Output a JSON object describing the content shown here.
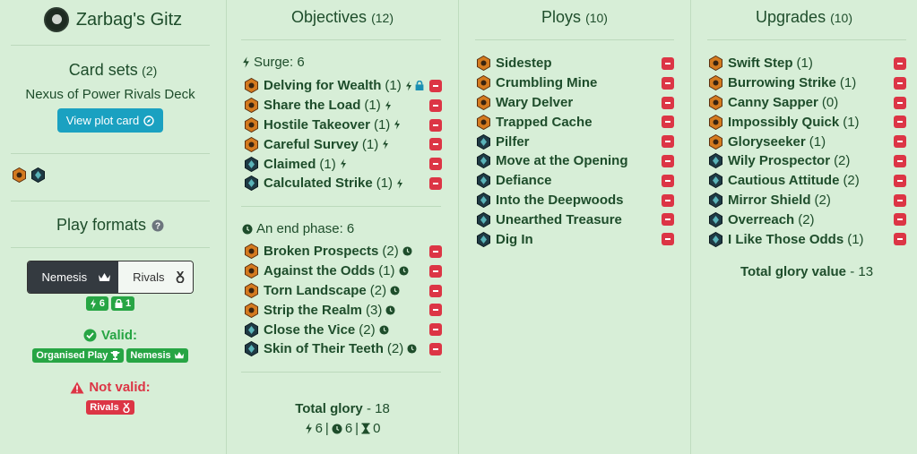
{
  "sidebar": {
    "warband_name": "Zarbag's Gitz",
    "card_sets": {
      "title": "Card sets",
      "count": "(2)",
      "deck_name": "Nexus of Power Rivals Deck",
      "plot_button": "View plot card"
    },
    "play_formats": {
      "title": "Play formats",
      "nemesis_label": "Nemesis",
      "rivals_label": "Rivals",
      "surge_count": "6",
      "lock_count": "1",
      "valid_label": "Valid:",
      "valid_badges": [
        "Organised Play",
        "Nemesis"
      ],
      "invalid_label": "Not valid:",
      "invalid_badges": [
        "Rivals"
      ]
    }
  },
  "objectives": {
    "title": "Objectives",
    "count": "(12)",
    "surge_group": {
      "label": "Surge: 6",
      "cards": [
        {
          "name": "Delving for Wealth",
          "glory": "(1)",
          "set": "orange",
          "lock": true
        },
        {
          "name": "Share the Load",
          "glory": "(1)",
          "set": "orange"
        },
        {
          "name": "Hostile Takeover",
          "glory": "(1)",
          "set": "orange"
        },
        {
          "name": "Careful Survey",
          "glory": "(1)",
          "set": "orange"
        },
        {
          "name": "Claimed",
          "glory": "(1)",
          "set": "dark"
        },
        {
          "name": "Calculated Strike",
          "glory": "(1)",
          "set": "dark"
        }
      ]
    },
    "end_group": {
      "label": "An end phase: 6",
      "cards": [
        {
          "name": "Broken Prospects",
          "glory": "(2)",
          "set": "orange"
        },
        {
          "name": "Against the Odds",
          "glory": "(1)",
          "set": "orange"
        },
        {
          "name": "Torn Landscape",
          "glory": "(2)",
          "set": "orange"
        },
        {
          "name": "Strip the Realm",
          "glory": "(3)",
          "set": "orange"
        },
        {
          "name": "Close the Vice",
          "glory": "(2)",
          "set": "dark"
        },
        {
          "name": "Skin of Their Teeth",
          "glory": "(2)",
          "set": "dark"
        }
      ]
    },
    "total_label": "Total glory",
    "total_value": "- 18",
    "summary": {
      "surge": "6",
      "end": "6",
      "third": "0"
    }
  },
  "ploys": {
    "title": "Ploys",
    "count": "(10)",
    "cards": [
      {
        "name": "Sidestep",
        "set": "orange"
      },
      {
        "name": "Crumbling Mine",
        "set": "orange"
      },
      {
        "name": "Wary Delver",
        "set": "orange"
      },
      {
        "name": "Trapped Cache",
        "set": "orange"
      },
      {
        "name": "Pilfer",
        "set": "dark"
      },
      {
        "name": "Move at the Opening",
        "set": "dark"
      },
      {
        "name": "Defiance",
        "set": "dark"
      },
      {
        "name": "Into the Deepwoods",
        "set": "dark"
      },
      {
        "name": "Unearthed Treasure",
        "set": "dark"
      },
      {
        "name": "Dig In",
        "set": "dark"
      }
    ]
  },
  "upgrades": {
    "title": "Upgrades",
    "count": "(10)",
    "cards": [
      {
        "name": "Swift Step",
        "glory": "(1)",
        "set": "orange"
      },
      {
        "name": "Burrowing Strike",
        "glory": "(1)",
        "set": "orange"
      },
      {
        "name": "Canny Sapper",
        "glory": "(0)",
        "set": "orange"
      },
      {
        "name": "Impossibly Quick",
        "glory": "(1)",
        "set": "orange"
      },
      {
        "name": "Gloryseeker",
        "glory": "(1)",
        "set": "orange"
      },
      {
        "name": "Wily Prospector",
        "glory": "(2)",
        "set": "dark"
      },
      {
        "name": "Cautious Attitude",
        "glory": "(2)",
        "set": "dark"
      },
      {
        "name": "Mirror Shield",
        "glory": "(2)",
        "set": "dark"
      },
      {
        "name": "Overreach",
        "glory": "(2)",
        "set": "dark"
      },
      {
        "name": "I Like Those Odds",
        "glory": "(1)",
        "set": "dark"
      }
    ],
    "total_label": "Total glory value",
    "total_value": "- 13"
  },
  "colors": {
    "background": "#d7eed7",
    "text": "#1e4d2b",
    "remove": "#dc3545",
    "valid": "#27a544",
    "button": "#1aa1c1"
  },
  "icons": {
    "orange_set": "orange-hex-icon",
    "dark_set": "dark-hex-icon",
    "surge": "lightning-icon",
    "end_phase": "clock-icon",
    "lock": "lock-icon",
    "remove": "minus-icon"
  }
}
